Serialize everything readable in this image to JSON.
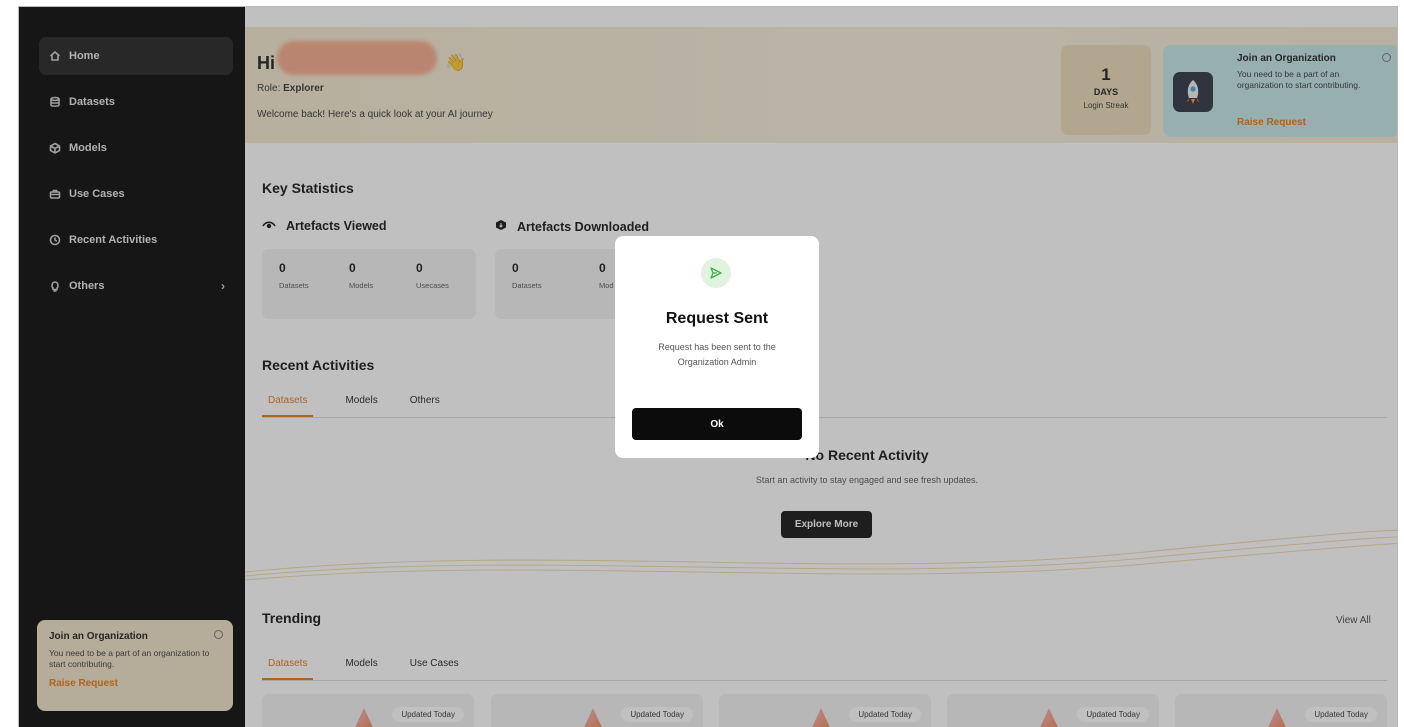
{
  "sidebar": {
    "items": [
      {
        "label": "Home",
        "icon": "home-icon"
      },
      {
        "label": "Datasets",
        "icon": "database-icon"
      },
      {
        "label": "Models",
        "icon": "cube-icon"
      },
      {
        "label": "Use Cases",
        "icon": "briefcase-icon"
      },
      {
        "label": "Recent Activities",
        "icon": "clock-icon"
      },
      {
        "label": "Others",
        "icon": "lightbulb-icon"
      }
    ],
    "join_card": {
      "title": "Join an Organization",
      "description": "You need to be a part of an organization to start contributing.",
      "action": "Raise Request"
    }
  },
  "header": {
    "greeting": "Hi",
    "role_label": "Role:",
    "role_value": "Explorer",
    "welcome": "Welcome back! Here's a quick look at your AI journey",
    "streak": {
      "value": "1",
      "unit": "DAYS",
      "label": "Login Streak"
    },
    "join_card": {
      "title": "Join an Organization",
      "description": "You need to be a part of an organization to start contributing.",
      "action": "Raise Request"
    }
  },
  "key_statistics": {
    "title": "Key Statistics",
    "viewed": {
      "title": "Artefacts Viewed",
      "stats": [
        {
          "value": "0",
          "label": "Datasets"
        },
        {
          "value": "0",
          "label": "Models"
        },
        {
          "value": "0",
          "label": "Usecases"
        }
      ]
    },
    "downloaded": {
      "title": "Artefacts Downloaded",
      "stats": [
        {
          "value": "0",
          "label": "Datasets"
        },
        {
          "value": "0",
          "label": "Mod"
        }
      ]
    }
  },
  "recent_activities": {
    "title": "Recent Activities",
    "tabs": [
      "Datasets",
      "Models",
      "Others"
    ],
    "empty_title": "No Recent Activity",
    "empty_desc": "Start an activity to stay engaged and see fresh updates.",
    "explore_label": "Explore More"
  },
  "trending": {
    "title": "Trending",
    "view_all": "View All",
    "tabs": [
      "Datasets",
      "Models",
      "Use Cases"
    ],
    "card_badge": "Updated Today"
  },
  "modal": {
    "title": "Request Sent",
    "description": "Request has been sent to the Organization Admin",
    "ok_label": "Ok"
  },
  "colors": {
    "accent": "#e8760f",
    "sidebar_bg": "#050505",
    "success_icon": "#3fae49"
  }
}
